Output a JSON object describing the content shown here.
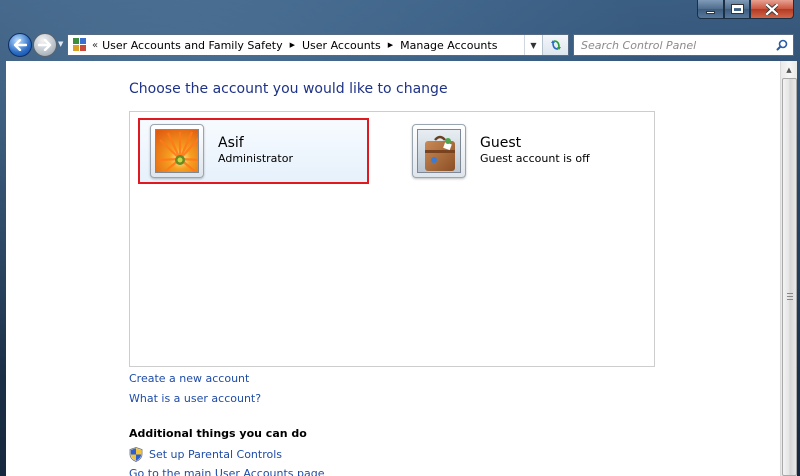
{
  "window": {
    "caption_minimize": "minimize",
    "caption_maximize": "maximize",
    "caption_close": "x"
  },
  "navigation": {
    "breadcrumbs": [
      "User Accounts and Family Safety",
      "User Accounts",
      "Manage Accounts"
    ],
    "search_placeholder": "Search Control Panel"
  },
  "main": {
    "heading": "Choose the account you would like to change",
    "accounts": [
      {
        "name": "Asif",
        "status": "Administrator",
        "selected": true,
        "picture": "orange-flower"
      },
      {
        "name": "Guest",
        "status": "Guest account is off",
        "selected": false,
        "picture": "suitcase"
      }
    ],
    "links": {
      "create_account": "Create a new account",
      "what_is_account": "What is a user account?"
    },
    "additional": {
      "title": "Additional things you can do",
      "parental_controls": "Set up Parental Controls",
      "main_page": "Go to the main User Accounts page"
    }
  },
  "colors": {
    "heading": "#1e3287",
    "link": "#1f4ca7",
    "selection_border": "#e0181f"
  }
}
